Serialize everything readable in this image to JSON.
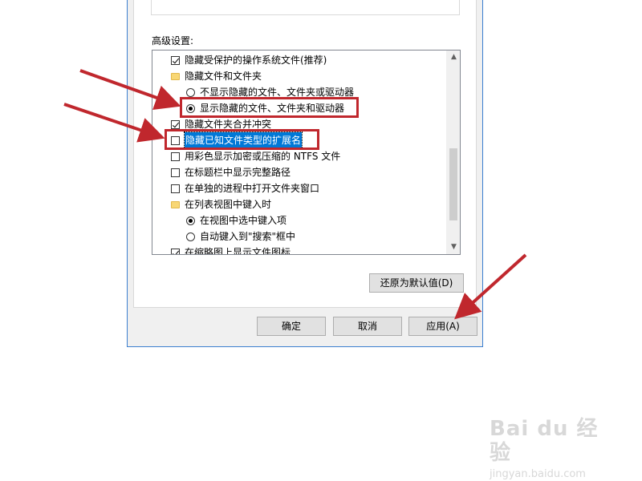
{
  "advanced_settings_label": "高级设置:",
  "tree_items": [
    {
      "type": "checkbox",
      "checked": true,
      "label": "隐藏受保护的操作系统文件(推荐)"
    },
    {
      "type": "folder",
      "label": "隐藏文件和文件夹"
    },
    {
      "type": "radio",
      "checked": false,
      "label": "不显示隐藏的文件、文件夹或驱动器"
    },
    {
      "type": "radio",
      "checked": true,
      "label": "显示隐藏的文件、文件夹和驱动器"
    },
    {
      "type": "checkbox",
      "checked": true,
      "label": "隐藏文件夹合并冲突"
    },
    {
      "type": "checkbox",
      "checked": false,
      "label": "隐藏已知文件类型的扩展名",
      "selected": true
    },
    {
      "type": "checkbox",
      "checked": false,
      "label": "用彩色显示加密或压缩的 NTFS 文件"
    },
    {
      "type": "checkbox",
      "checked": false,
      "label": "在标题栏中显示完整路径"
    },
    {
      "type": "checkbox",
      "checked": false,
      "label": "在单独的进程中打开文件夹窗口"
    },
    {
      "type": "folder",
      "label": "在列表视图中键入时"
    },
    {
      "type": "radio",
      "checked": true,
      "label": "在视图中选中键入项"
    },
    {
      "type": "radio",
      "checked": false,
      "label": "自动键入到\"搜索\"框中"
    },
    {
      "type": "checkbox",
      "checked": true,
      "label": "在缩略图上显示文件图标"
    }
  ],
  "scroll_up_glyph": "▲",
  "scroll_down_glyph": "▼",
  "buttons": {
    "restore_defaults": "还原为默认值(D)",
    "ok": "确定",
    "cancel": "取消",
    "apply": "应用(A)"
  },
  "watermark": {
    "brand": "Bai du 经验",
    "url": "jingyan.baidu.com"
  },
  "colors": {
    "annotation_red": "#c0272d",
    "selection_blue": "#0078d7",
    "window_border": "#3c7fd0"
  }
}
